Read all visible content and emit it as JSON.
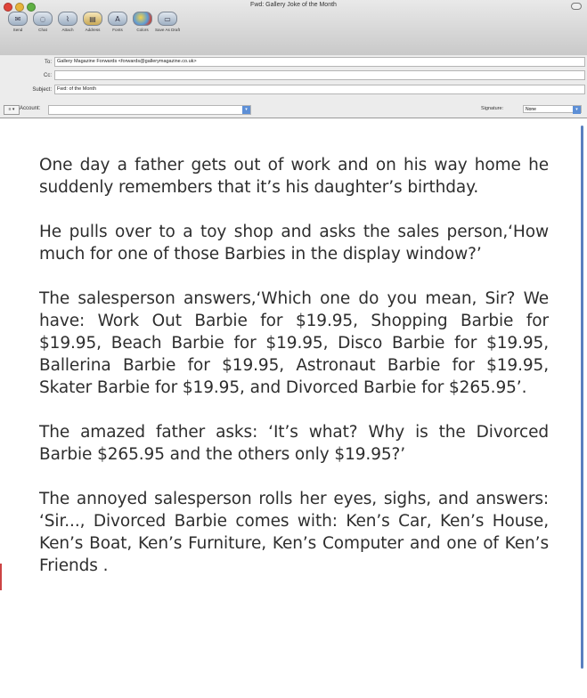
{
  "window": {
    "title": "Fwd: Gallery Joke of the Month"
  },
  "toolbar": {
    "buttons": [
      {
        "label": "Send",
        "icon": "send-icon"
      },
      {
        "label": "Chat",
        "icon": "chat-icon"
      },
      {
        "label": "Attach",
        "icon": "paperclip-icon"
      },
      {
        "label": "Address",
        "icon": "address-book-icon"
      },
      {
        "label": "Fonts",
        "icon": "fonts-icon"
      },
      {
        "label": "Colors",
        "icon": "colors-icon"
      },
      {
        "label": "Save As Draft",
        "icon": "save-draft-icon"
      }
    ]
  },
  "header": {
    "to_label": "To:",
    "to_value": "Gallery Magazine Forwards <forwards@gallerymagazine.co.uk>",
    "cc_label": "Cc:",
    "cc_value": "",
    "subject_label": "Subject:",
    "subject_value": "Fwd: of the Month",
    "account_button": "≡ ▾",
    "account_label": "Account:",
    "account_value": "",
    "signature_label": "Signature:",
    "signature_value": "None"
  },
  "message": {
    "paragraphs": [
      "One day a father gets out of work and on his way home he suddenly remembers that it’s his daughter’s birthday.",
      "He pulls over to a toy shop and asks the sales person,‘How much for one of those Barbies in the display window?’",
      "The salesperson answers,‘Which one do you mean, Sir? We have: Work Out Barbie for $19.95, Shopping Barbie for $19.95, Beach Barbie for $19.95, Disco Barbie for $19.95, Ballerina Barbie for $19.95, Astronaut Barbie for $19.95, Skater Barbie for $19.95, and Divorced Barbie for $265.95’.",
      "The amazed father asks: ‘It’s what? Why is the Divorced Barbie $265.95 and the others only $19.95?’",
      "The annoyed salesperson rolls her eyes, sighs, and answers: ‘Sir..., Divorced Barbie comes with: Ken’s Car, Ken’s House, Ken’s Boat, Ken’s Furniture, Ken’s Computer and one of Ken’s Friends ."
    ]
  },
  "colors": {
    "accent": "#5d8fd6",
    "text": "#2e2e2e"
  }
}
